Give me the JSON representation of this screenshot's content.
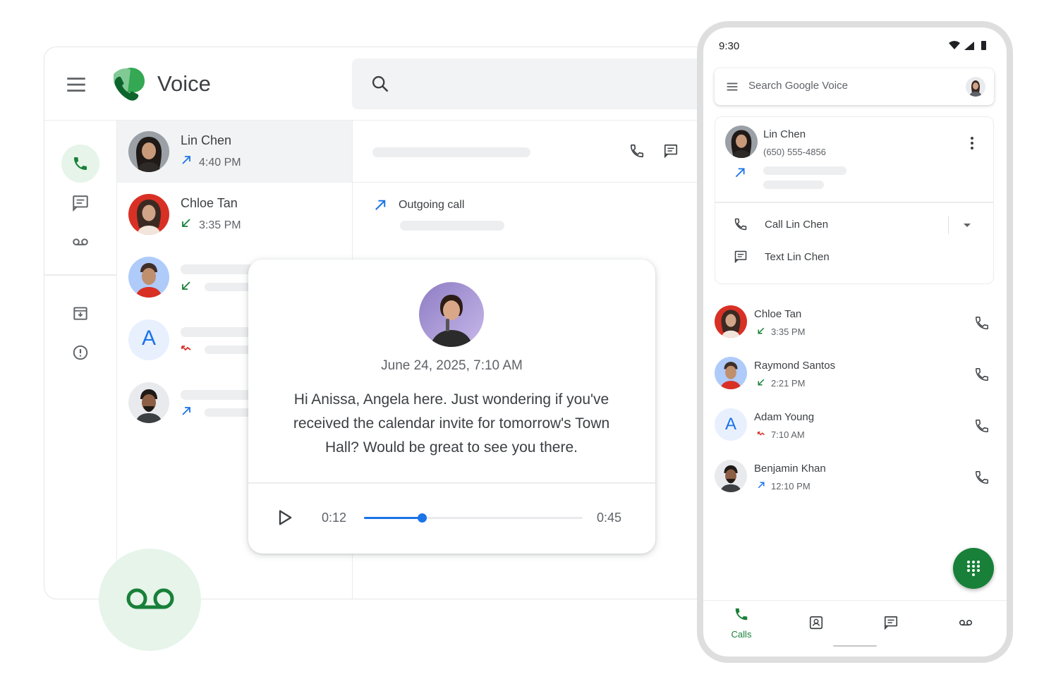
{
  "app": {
    "title": "Voice"
  },
  "desktop": {
    "calls": [
      {
        "name": "Lin Chen",
        "time": "4:40 PM",
        "direction": "outgoing"
      },
      {
        "name": "Chloe Tan",
        "time": "3:35 PM",
        "direction": "incoming"
      },
      {
        "name": "",
        "time": "",
        "direction": "incoming"
      },
      {
        "name": "",
        "time": "",
        "direction": "missed",
        "initial": "A"
      },
      {
        "name": "",
        "time": "",
        "direction": "outgoing"
      }
    ],
    "detail": {
      "event_label": "Outgoing call"
    }
  },
  "voicemail": {
    "date": "June 24, 2025, 7:10 AM",
    "transcript": "Hi Anissa, Angela here. Just wondering if you've received the calendar invite for tomorrow's Town Hall? Would be great to see you there.",
    "current_time": "0:12",
    "total_time": "0:45",
    "progress": 0.266
  },
  "phone": {
    "status_time": "9:30",
    "search_placeholder": "Search Google Voice",
    "contact_card": {
      "name": "Lin Chen",
      "number": "(650) 555-4856",
      "call_action": "Call Lin Chen",
      "text_action": "Text Lin Chen"
    },
    "calls": [
      {
        "name": "Chloe Tan",
        "time": "3:35 PM",
        "direction": "incoming"
      },
      {
        "name": "Raymond Santos",
        "time": "2:21 PM",
        "direction": "incoming"
      },
      {
        "name": "Adam Young",
        "time": "7:10 AM",
        "direction": "missed",
        "initial": "A"
      },
      {
        "name": "Benjamin Khan",
        "time": "12:10 PM",
        "direction": "outgoing"
      }
    ],
    "nav": {
      "calls_label": "Calls"
    }
  },
  "colors": {
    "green": "#188038",
    "green_light": "#e6f4ea",
    "blue": "#1a73e8",
    "red": "#d93025"
  }
}
